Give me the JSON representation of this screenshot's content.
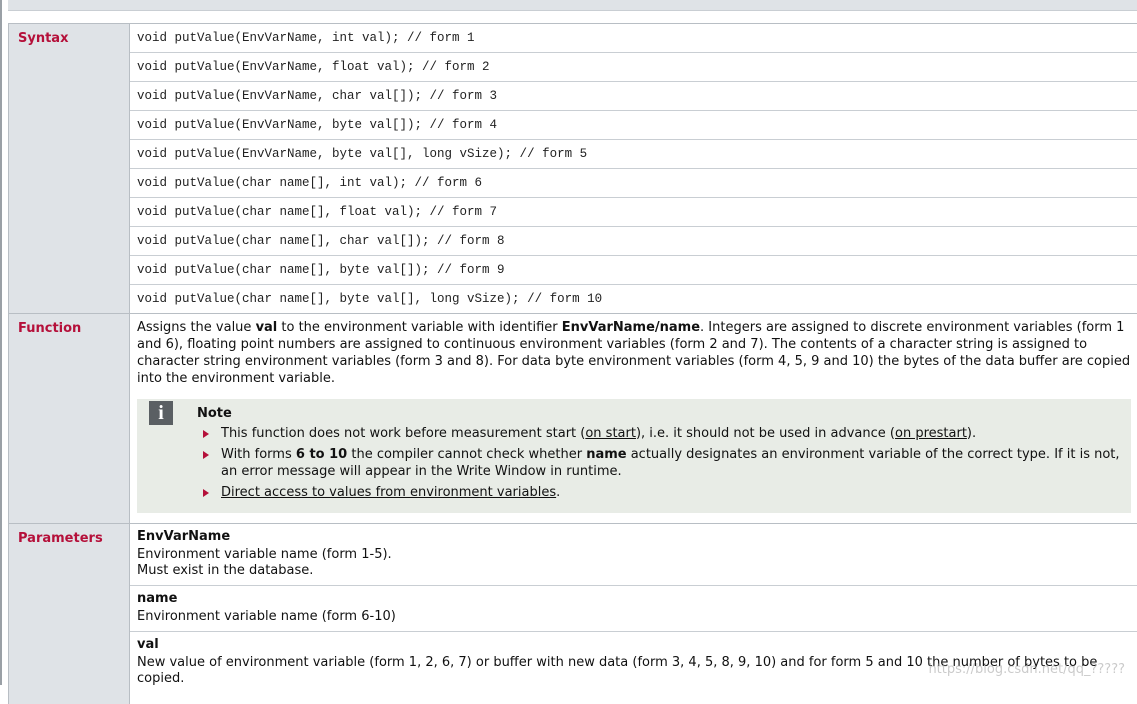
{
  "labels": {
    "syntax": "Syntax",
    "function": "Function",
    "parameters": "Parameters"
  },
  "syntax_lines": [
    "void putValue(EnvVarName, int val); // form 1",
    "void putValue(EnvVarName, float val); // form 2",
    "void putValue(EnvVarName, char val[]); // form 3",
    "void putValue(EnvVarName, byte val[]); // form 4",
    "void putValue(EnvVarName, byte val[], long vSize); // form 5",
    "void putValue(char name[], int val); // form 6",
    "void putValue(char name[], float val); // form 7",
    "void putValue(char name[], char val[]); // form 8",
    "void putValue(char name[], byte val[]); // form 9",
    "void putValue(char name[], byte val[], long vSize); // form 10"
  ],
  "function": {
    "p1": "Assigns the value ",
    "b1": "val",
    "p2": " to the environment variable with identifier ",
    "b2": "EnvVarName/name",
    "p3": ". Integers are assigned to discrete environment variables (form 1 and 6), floating point numbers are assigned to continuous environment variables (form 2 and 7). The contents of a character string is assigned to character string environment variables (form 3 and 8). For data byte environment variables (form 4, 5, 9 and 10) the bytes of the data buffer are copied into the environment variable."
  },
  "note": {
    "icon_letter": "i",
    "title": "Note",
    "item1_a": "This function does not work before measurement start (",
    "item1_link1": "on start",
    "item1_b": "), i.e. it should not be used in advance (",
    "item1_link2": "on prestart",
    "item1_c": ").",
    "item2_a": "With forms ",
    "item2_b1": "6 to 10",
    "item2_b": " the compiler cannot check whether ",
    "item2_b2": "name",
    "item2_c": " actually designates an environment variable of the correct type. If it is not, an error message will appear in the Write Window in runtime.",
    "item3_link": "Direct access to values from environment variables",
    "item3_end": "."
  },
  "parameters": [
    {
      "name": "EnvVarName",
      "desc": [
        "Environment variable name (form 1-5).",
        "Must exist in the database."
      ]
    },
    {
      "name": "name",
      "desc": [
        "Environment variable name (form 6-10)"
      ]
    },
    {
      "name": "val",
      "desc": [
        "New value of environment variable (form 1, 2, 6, 7) or buffer with new data (form 3, 4, 5, 8, 9, 10) and for form 5 and 10 the number of bytes to be copied."
      ]
    }
  ],
  "watermark": "https://blog.csdn.net/qq_?????"
}
